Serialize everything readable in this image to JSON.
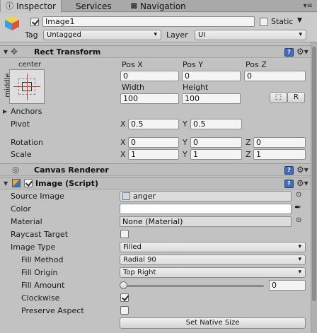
{
  "tabs": [
    {
      "label": "Inspector",
      "icon": "inspector-icon",
      "active": true
    },
    {
      "label": "Services",
      "icon": "",
      "active": false
    },
    {
      "label": "Navigation",
      "icon": "navigation-icon",
      "active": false
    }
  ],
  "object": {
    "name": "Image1",
    "static_label": "Static",
    "tag_label": "Tag",
    "tag_value": "Untagged",
    "layer_label": "Layer",
    "layer_value": "UI"
  },
  "rect_transform": {
    "title": "Rect Transform",
    "anchor_h": "center",
    "anchor_v": "middle",
    "pos_x_label": "Pos X",
    "pos_x": "0",
    "pos_y_label": "Pos Y",
    "pos_y": "0",
    "pos_z_label": "Pos Z",
    "pos_z": "0",
    "width_label": "Width",
    "width": "100",
    "height_label": "Height",
    "height": "100",
    "raw_button": "R",
    "anchors_label": "Anchors",
    "pivot_label": "Pivot",
    "pivot_x": "0.5",
    "pivot_y": "0.5",
    "rotation_label": "Rotation",
    "rot_x": "0",
    "rot_y": "0",
    "rot_z": "0",
    "scale_label": "Scale",
    "scale_x": "1",
    "scale_y": "1",
    "scale_z": "1",
    "x": "X",
    "y": "Y",
    "z": "Z"
  },
  "canvas_renderer": {
    "title": "Canvas Renderer"
  },
  "image": {
    "title": "Image (Script)",
    "source_image_label": "Source Image",
    "source_image": "anger",
    "color_label": "Color",
    "material_label": "Material",
    "material": "None (Material)",
    "raycast_label": "Raycast Target",
    "image_type_label": "Image Type",
    "image_type": "Filled",
    "fill_method_label": "Fill Method",
    "fill_method": "Radial 90",
    "fill_origin_label": "Fill Origin",
    "fill_origin": "Top Right",
    "fill_amount_label": "Fill Amount",
    "fill_amount": "0",
    "clockwise_label": "Clockwise",
    "preserve_label": "Preserve Aspect",
    "native_size_button": "Set Native Size"
  },
  "colors": {
    "accent": "#3e6dbe",
    "panel": "#c2c2c2",
    "header": "#bdbdbd"
  }
}
